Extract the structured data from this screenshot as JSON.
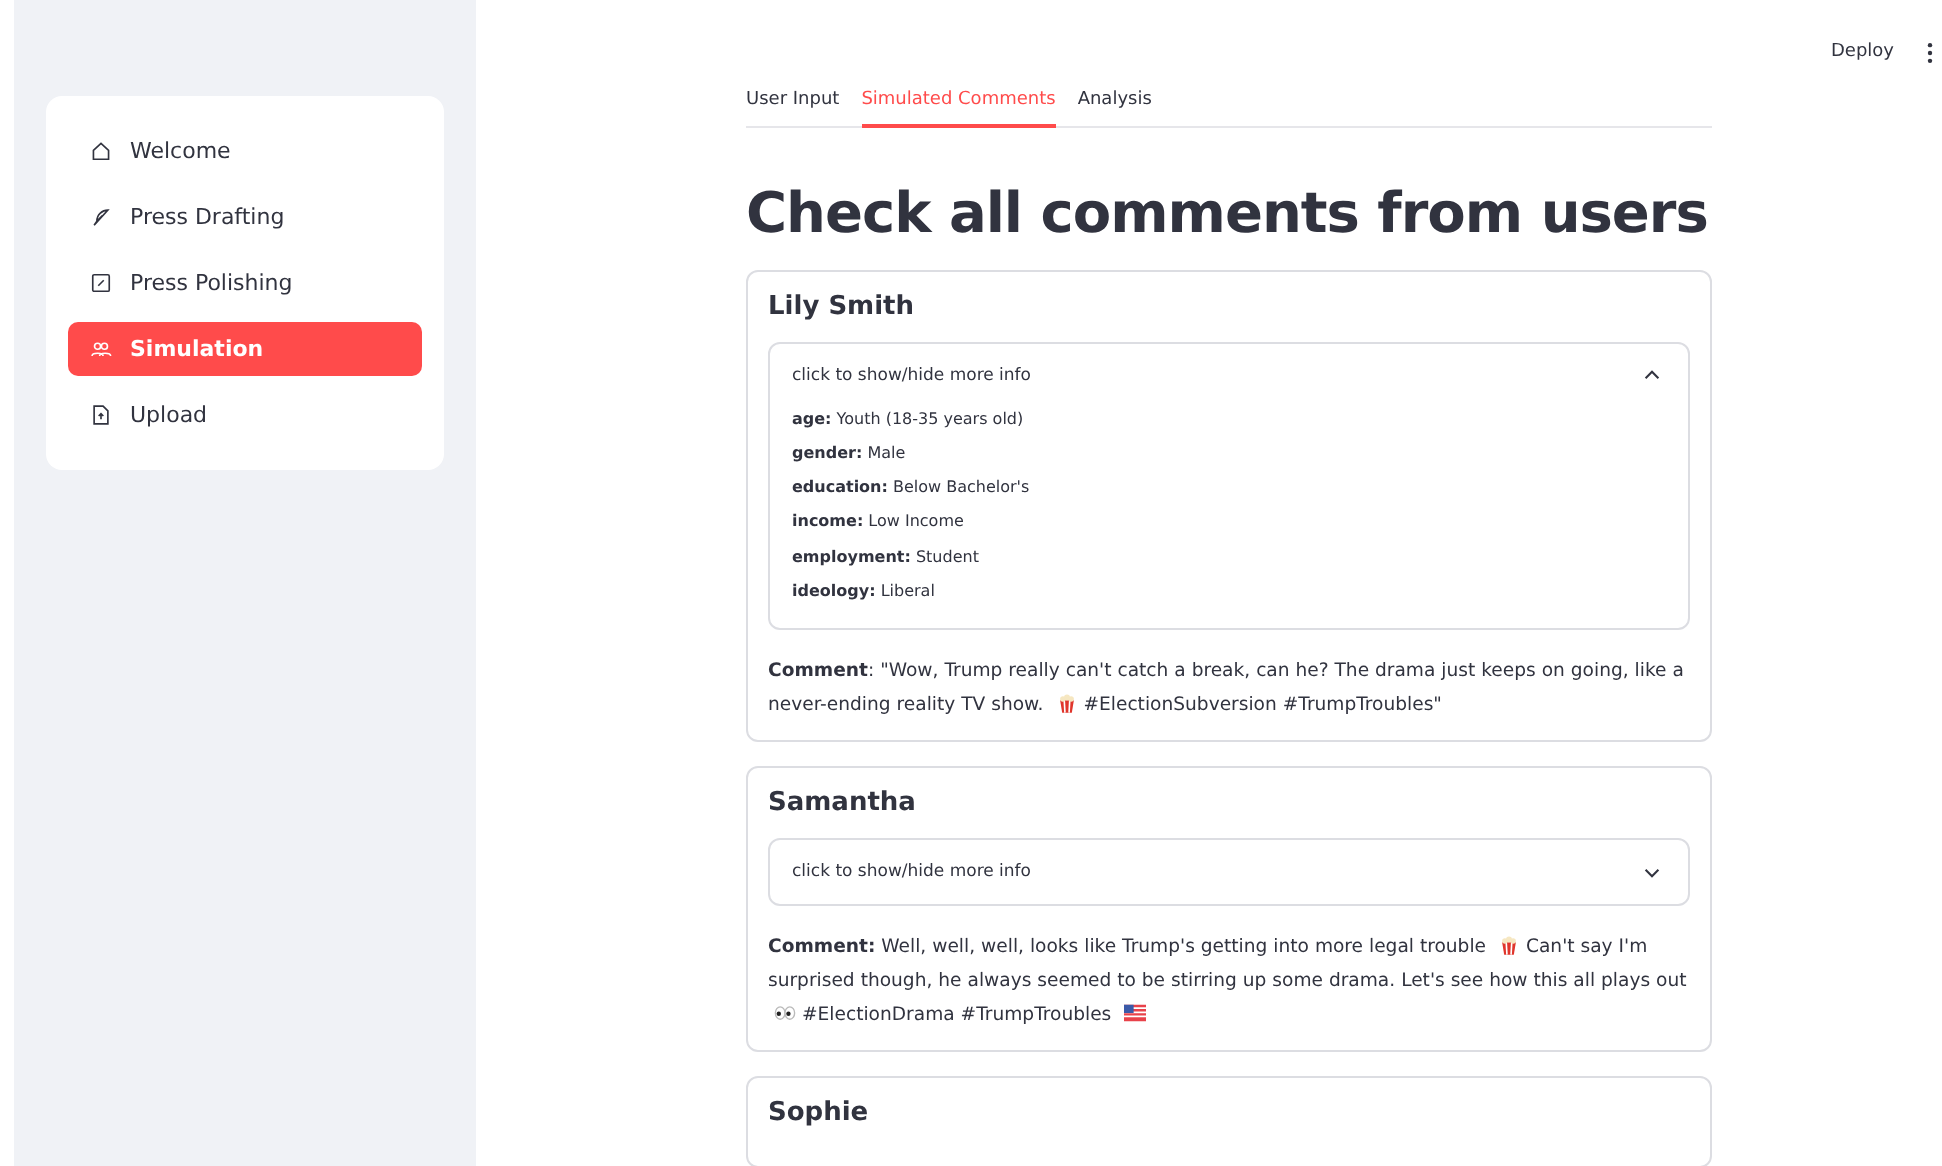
{
  "sidebar": {
    "items": [
      {
        "label": "Welcome",
        "selected": false
      },
      {
        "label": "Press Drafting",
        "selected": false
      },
      {
        "label": "Press Polishing",
        "selected": false
      },
      {
        "label": "Simulation",
        "selected": true
      },
      {
        "label": "Upload",
        "selected": false
      }
    ]
  },
  "header": {
    "deploy": "Deploy"
  },
  "tabs": [
    {
      "label": "User Input",
      "selected": false
    },
    {
      "label": "Simulated Comments",
      "selected": true
    },
    {
      "label": "Analysis",
      "selected": false
    }
  ],
  "title": "Check all comments from users",
  "comments": [
    {
      "name": "Lily Smith",
      "expander": {
        "label": "click to show/hide more info",
        "expanded": true,
        "details": [
          "**age:** Youth (18-35 years old)",
          "**gender:** Male",
          "**education:** Below Bachelor's",
          "**income:** Low Income",
          "**employment:** Student",
          "**ideology:** Liberal"
        ]
      },
      "comment": [
        {
          "kind": "text",
          "text": "**Comment**: \"Wow, Trump really can't catch a break, can he? The drama just keeps on going, like a never-ending reality TV show."
        },
        {
          "kind": "popcorn"
        },
        {
          "kind": "text",
          "text": "#ElectionSubversion #TrumpTroubles\""
        }
      ]
    },
    {
      "name": "Samantha",
      "expander": {
        "label": "click to show/hide more info",
        "expanded": false
      },
      "comment": [
        {
          "kind": "text",
          "text": "**Comment:** Well, well, well, looks like Trump's getting into more legal trouble"
        },
        {
          "kind": "popcorn"
        },
        {
          "kind": "text",
          "text": "Can't say I'm surprised though, he always seemed to be stirring up some drama. Let's see how this all plays out"
        },
        {
          "kind": "eyes"
        },
        {
          "kind": "text",
          "text": "#ElectionDrama #TrumpTroubles"
        },
        {
          "kind": "flag"
        }
      ]
    },
    {
      "name": "Sophie"
    }
  ]
}
